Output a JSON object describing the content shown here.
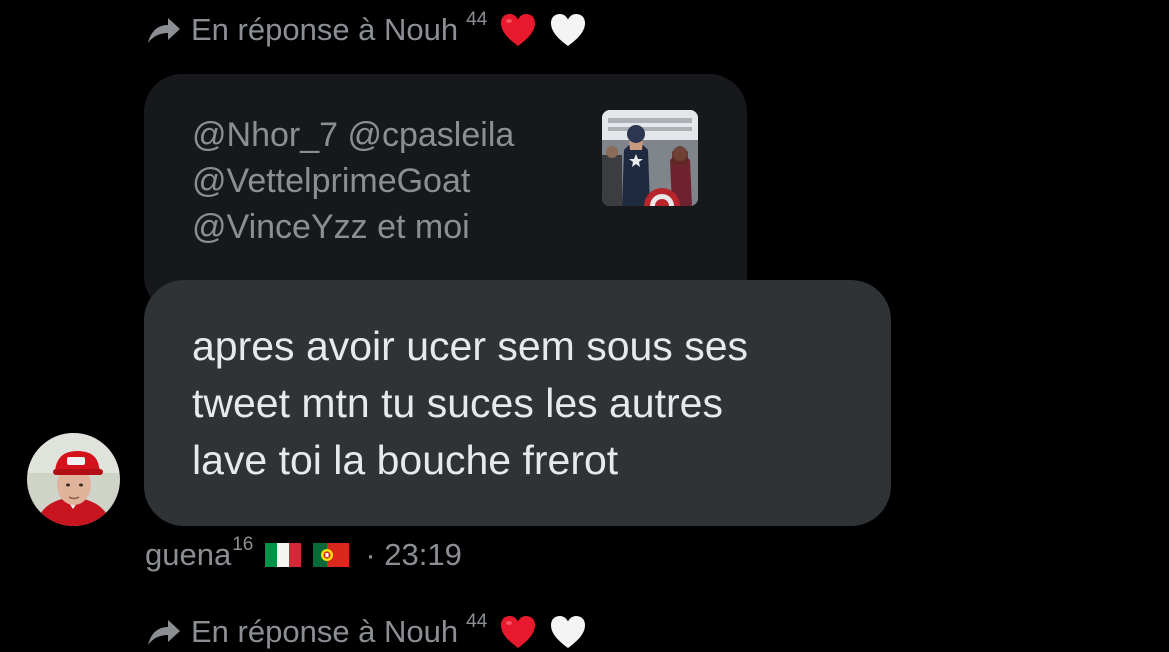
{
  "reply_header_top": {
    "text": "En réponse à Nouh",
    "badge": "44",
    "icon": "reply-arrow-icon",
    "emojis": [
      "red-heart",
      "white-heart"
    ]
  },
  "quoted_message": {
    "lines": [
      "@Nhor_7 @cpasleila",
      "@VettelprimeGoat",
      "@VinceYzz et moi"
    ],
    "thumbnail": "movie-still-thumbnail"
  },
  "message": {
    "lines": [
      "apres avoir ucer sem sous ses",
      "tweet mtn tu suces les autres",
      "lave toi la bouche frerot"
    ]
  },
  "sender": {
    "name": "guena",
    "badge": "16",
    "flags": [
      "italy-flag",
      "portugal-flag"
    ],
    "time": "· 23:19",
    "avatar": "user-avatar"
  },
  "reply_header_bottom": {
    "text": "En réponse à Nouh",
    "badge": "44",
    "icon": "reply-arrow-icon",
    "emojis": [
      "red-heart",
      "white-heart"
    ]
  },
  "colors": {
    "background": "#000000",
    "quoted_bubble": "#16181c",
    "message_bubble": "#2f3336",
    "muted_text": "#8b8f94",
    "primary_text": "#e7e9ea",
    "heart_red": "#e8192c"
  }
}
